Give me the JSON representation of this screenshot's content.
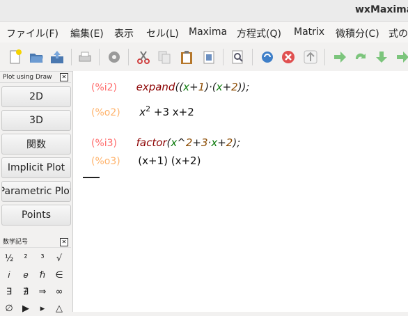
{
  "window": {
    "title": "wxMaxima"
  },
  "menu": [
    "ファイル(F)",
    "編集(E)",
    "表示",
    "セル(L)",
    "Maxima",
    "方程式(Q)",
    "Matrix",
    "微積分(C)",
    "式の"
  ],
  "plot_panel": {
    "title": "Plot using Draw",
    "buttons": [
      "2D",
      "3D",
      "関数",
      "Implicit Plot",
      "Parametric Plot",
      "Points"
    ]
  },
  "symbols_panel": {
    "title": "数学記号",
    "rows": [
      [
        "½",
        "²",
        "³",
        "√"
      ],
      [
        "𝑖",
        "𝑒",
        "ℏ",
        "∈"
      ],
      [
        "∃",
        "∄",
        "⇒",
        "∞"
      ],
      [
        "∅",
        "▶",
        "▸",
        "△"
      ]
    ]
  },
  "worksheet": {
    "cells": [
      {
        "label": "(%i2)",
        "kind": "input",
        "tokens": [
          {
            "t": "expand",
            "c": "fn"
          },
          {
            "t": "((",
            "c": "op"
          },
          {
            "t": "x",
            "c": "var"
          },
          {
            "t": "+",
            "c": "op"
          },
          {
            "t": "1",
            "c": "num"
          },
          {
            "t": ")·(",
            "c": "op"
          },
          {
            "t": "x",
            "c": "var"
          },
          {
            "t": "+",
            "c": "op"
          },
          {
            "t": "2",
            "c": "num"
          },
          {
            "t": "));",
            "c": "op"
          }
        ]
      },
      {
        "label": "(%o2)",
        "kind": "output",
        "text": "x",
        "sup": "2",
        "rest": " +3 x+2"
      },
      {
        "label": "(%i3)",
        "kind": "input",
        "tokens": [
          {
            "t": "factor",
            "c": "fn"
          },
          {
            "t": "(",
            "c": "op"
          },
          {
            "t": "x",
            "c": "var"
          },
          {
            "t": "^",
            "c": "op"
          },
          {
            "t": "2",
            "c": "num"
          },
          {
            "t": "+",
            "c": "op"
          },
          {
            "t": "3",
            "c": "num"
          },
          {
            "t": "·",
            "c": "op"
          },
          {
            "t": "x",
            "c": "var"
          },
          {
            "t": "+",
            "c": "op"
          },
          {
            "t": "2",
            "c": "num"
          },
          {
            "t": ");",
            "c": "op"
          }
        ]
      },
      {
        "label": "(%o3)",
        "kind": "output",
        "text": "(x+1) (x+2)"
      }
    ]
  },
  "colors": {
    "input_label": "#ff6a6a",
    "output_label": "#ffb36b",
    "function": "#8b0000",
    "variable": "#0a7a0a",
    "number": "#8b4a00"
  }
}
